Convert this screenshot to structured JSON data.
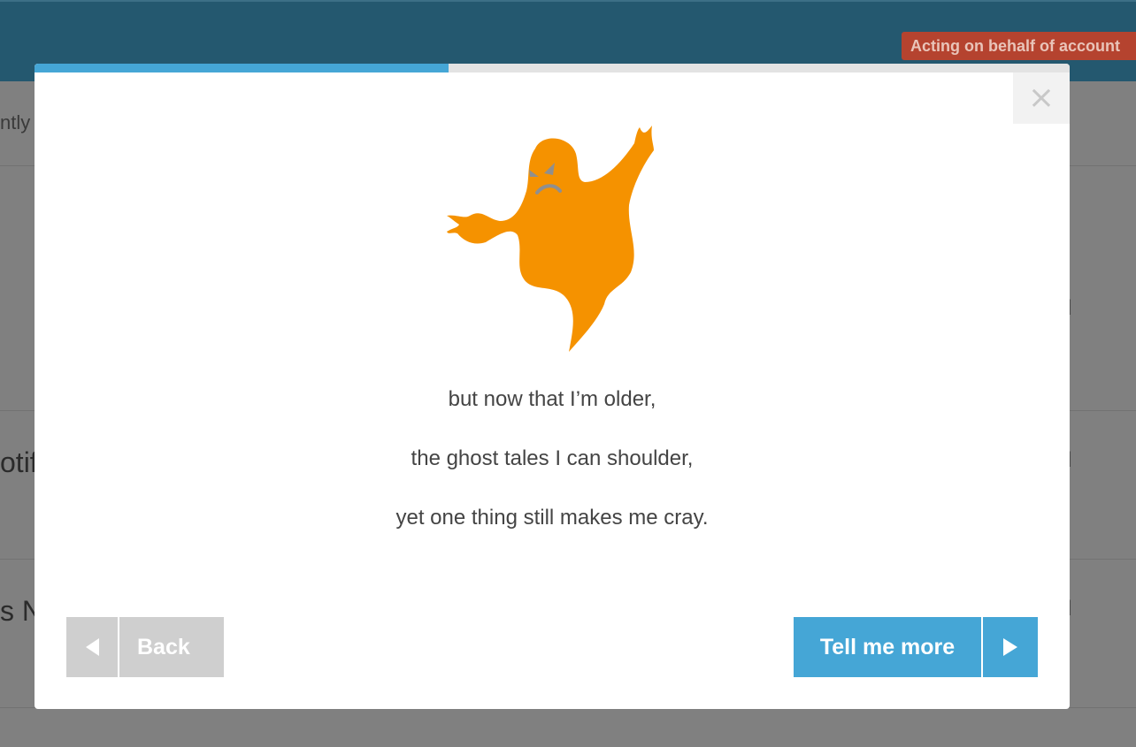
{
  "header": {
    "acting_badge": "Acting on behalf of account"
  },
  "page": {
    "rows": [
      {
        "left_text": "ntly",
        "right_text": ""
      },
      {
        "left_text": "",
        "right_text": "d"
      },
      {
        "left_text": "otifi",
        "right_text": "d"
      },
      {
        "left_text": "s Ne",
        "right_text": "d"
      }
    ]
  },
  "modal": {
    "progress": 0.4,
    "close_label": "×",
    "illustration": "angry-ghost-icon",
    "ghost_color": "#f59200",
    "verse": [
      "but now that I’m older,",
      "the ghost tales I can shoulder,",
      "yet one thing still makes me cray."
    ],
    "back_label": "Back",
    "next_label": "Tell me more"
  },
  "colors": {
    "header": "#24586f",
    "accent": "#45a6d6",
    "badge": "#b5432f",
    "back_button": "#cfcfcf"
  }
}
